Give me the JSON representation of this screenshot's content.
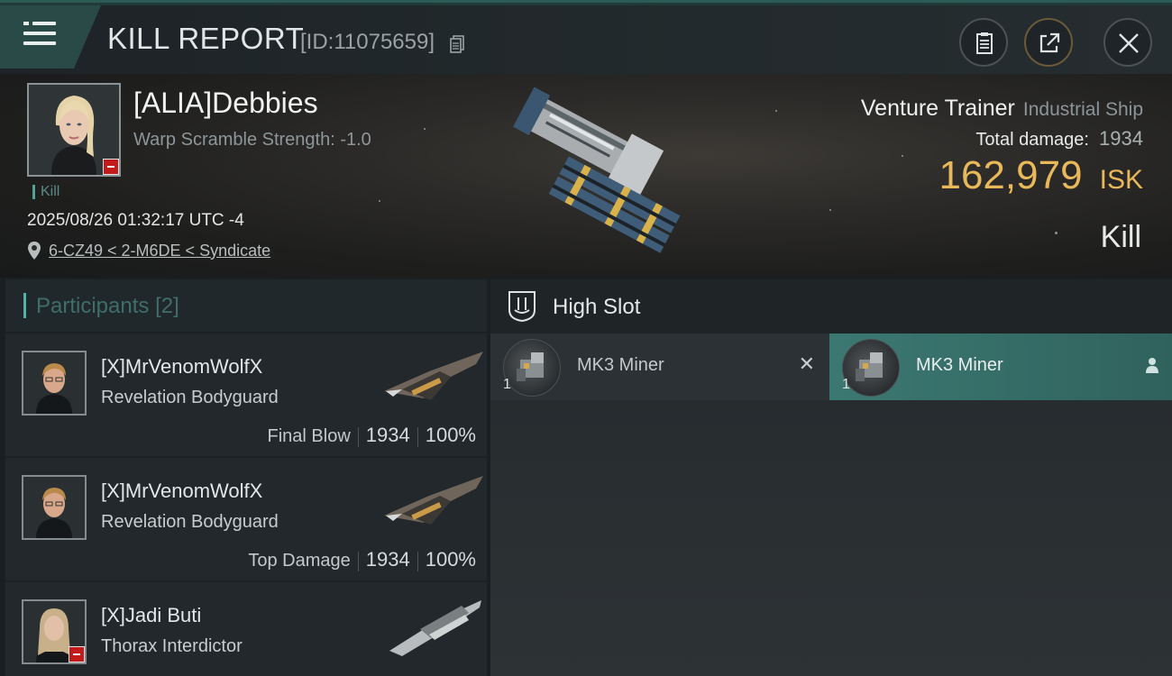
{
  "header": {
    "title": "KILL REPORT",
    "report_id": "[ID:11075659]"
  },
  "victim": {
    "name": "[ALIA]Debbies",
    "warp_scramble": "Warp Scramble Strength: -1.0",
    "tag": "Kill",
    "datetime": "2025/08/26 01:32:17 UTC -4",
    "location": "6-CZ49 < 2-M6DE < Syndicate"
  },
  "ship": {
    "name": "Venture Trainer",
    "class": "Industrial Ship",
    "total_damage_label": "Total damage:",
    "total_damage": "1934",
    "isk_value": "162,979",
    "isk_unit": "ISK",
    "result": "Kill"
  },
  "participants": {
    "label": "Participants",
    "count": "[2]",
    "rows": [
      {
        "name": "[X]MrVenomWolfX",
        "ship": "Revelation Bodyguard",
        "role": "Final Blow",
        "damage": "1934",
        "percent": "100%"
      },
      {
        "name": "[X]MrVenomWolfX",
        "ship": "Revelation Bodyguard",
        "role": "Top Damage",
        "damage": "1934",
        "percent": "100%"
      },
      {
        "name": "[X]Jadi Buti",
        "ship": "Thorax Interdictor"
      }
    ]
  },
  "fittings": {
    "slot_label": "High Slot",
    "modules": [
      {
        "name": "MK3 Miner",
        "qty": "1",
        "status": "destroyed"
      },
      {
        "name": "MK3 Miner",
        "qty": "1",
        "status": "dropped"
      }
    ]
  },
  "colors": {
    "accent_teal": "#4fb3a9",
    "isk_gold": "#e9b85a",
    "security_red": "#c21b1b",
    "dropped_bg": "#3c7872"
  },
  "icons": [
    "menu-icon",
    "copy-icon",
    "clipboard-icon",
    "share-icon",
    "close-icon",
    "location-pin-icon",
    "high-slot-icon",
    "destroyed-x-icon",
    "person-icon"
  ]
}
